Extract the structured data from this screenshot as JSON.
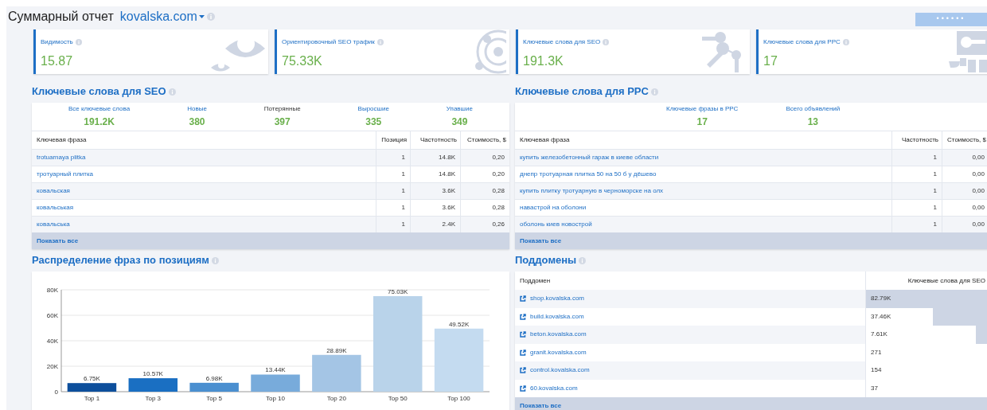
{
  "header": {
    "title": "Суммарный отчет",
    "domain": "kovalska.com",
    "action_button": "••••••"
  },
  "metric_cards": [
    {
      "label": "Видимость",
      "value": "15.87",
      "kind": "eye"
    },
    {
      "label": "Ориентировочный SEO трафик",
      "value": "75.33K",
      "kind": "orbit"
    },
    {
      "label": "Ключевые слова для SEO",
      "value": "191.3K",
      "kind": "keys"
    },
    {
      "label": "Ключевые слова для PPC",
      "value": "17",
      "kind": "ppc"
    }
  ],
  "seo_keywords": {
    "title": "Ключевые слова для SEO",
    "stats": [
      {
        "label": "Все ключевые слова",
        "value": "191.2K",
        "link": true
      },
      {
        "label": "Новые",
        "value": "380",
        "link": true
      },
      {
        "label": "Потерянные",
        "value": "397",
        "link": false
      },
      {
        "label": "Выросшие",
        "value": "335",
        "link": true
      },
      {
        "label": "Упавшие",
        "value": "349",
        "link": true
      }
    ],
    "columns": [
      "Ключевая фраза",
      "Позиция",
      "Частотность",
      "Стоимость, $"
    ],
    "rows": [
      [
        "trotuarnaya plitka",
        "1",
        "14.8K",
        "0,20"
      ],
      [
        "тротуарный плитка",
        "1",
        "14.8K",
        "0,20"
      ],
      [
        "ковальская",
        "1",
        "3.6K",
        "0,28"
      ],
      [
        "ковальськая",
        "1",
        "3.6K",
        "0,28"
      ],
      [
        "ковальська",
        "1",
        "2.4K",
        "0,26"
      ]
    ],
    "footer": "Показать все"
  },
  "ppc_keywords": {
    "title": "Ключевые слова для PPC",
    "stats": [
      {
        "label": "Ключевые фразы в PPC",
        "value": "17",
        "link": true
      },
      {
        "label": "Всего объявлений",
        "value": "13",
        "link": true
      }
    ],
    "columns": [
      "Ключевая фраза",
      "Частотность",
      "Стоимость, $"
    ],
    "rows": [
      [
        "купить железобетонный гараж в киеве области",
        "1",
        "0,00"
      ],
      [
        "днепр тротуарная плитка 50 на 50 б у дёшево",
        "1",
        "0,00"
      ],
      [
        "купить плитку тротуарную в черноморске на олх",
        "1",
        "0,00"
      ],
      [
        "навастрой на оболони",
        "1",
        "0,00"
      ],
      [
        "оболонь киев новострой",
        "1",
        "0,00"
      ]
    ],
    "footer": "Показать все"
  },
  "position_distribution": {
    "title": "Распределение фраз по позициям",
    "chart_data": {
      "type": "bar",
      "categories": [
        "Top 1",
        "Top 3",
        "Top 5",
        "Top 10",
        "Top 20",
        "Top 50",
        "Top 100"
      ],
      "series": [
        {
          "values": [
            6750,
            10570,
            6980,
            13440,
            28890,
            75030,
            49520
          ]
        }
      ],
      "colors": [
        "#0d4f9c",
        "#1a6fc2",
        "#4a8fd0",
        "#78abdb",
        "#a4c5e5",
        "#b9d3ea",
        "#c4dbf0"
      ],
      "grid": true,
      "ylim": [
        0,
        80000
      ],
      "yticks": [
        {
          "value": 0,
          "label": "0"
        },
        {
          "value": 20000,
          "label": "20K"
        },
        {
          "value": 40000,
          "label": "40K"
        },
        {
          "value": 60000,
          "label": "60K"
        },
        {
          "value": 80000,
          "label": "80K"
        }
      ],
      "value_labels": [
        "6.75K",
        "10.57K",
        "6.98K",
        "13.44K",
        "28.89K",
        "75.03K",
        "49.52K"
      ]
    }
  },
  "subdomains": {
    "title": "Поддомены",
    "columns": [
      "Поддомен",
      "Ключевые слова для SEO"
    ],
    "rows": [
      {
        "domain": "shop.kovalska.com",
        "keywords": "82.79K",
        "level": 1
      },
      {
        "domain": "build.kovalska.com",
        "keywords": "37.46K",
        "level": 0.45
      },
      {
        "domain": "beton.kovalska.com",
        "keywords": "7.61K",
        "level": 0.09
      },
      {
        "domain": "granit.kovalska.com",
        "keywords": "271",
        "level": 0.003
      },
      {
        "domain": "control.kovalska.com",
        "keywords": "154",
        "level": 0.002
      },
      {
        "domain": "60.kovalska.com",
        "keywords": "37",
        "level": 0.0004
      }
    ],
    "footer": "Показать все"
  }
}
